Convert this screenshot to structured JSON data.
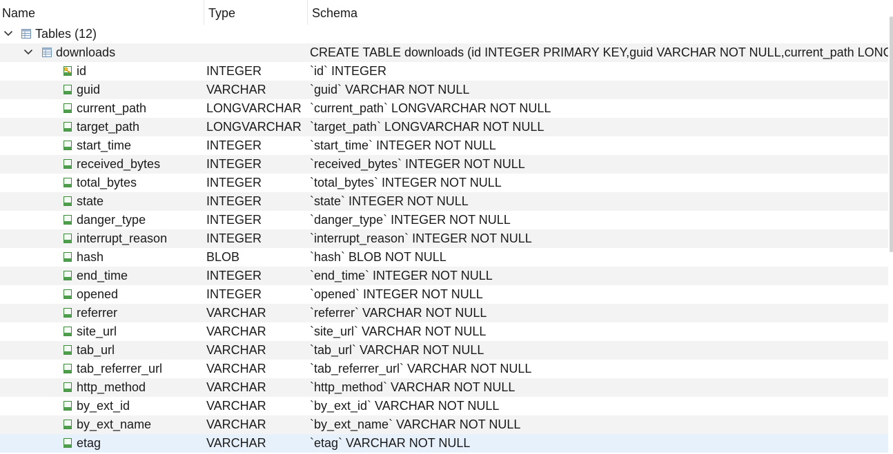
{
  "header": {
    "name_label": "Name",
    "type_label": "Type",
    "schema_label": "Schema"
  },
  "tables_node": {
    "label": "Tables (12)",
    "expanded": true,
    "icon": "table-icon"
  },
  "table": {
    "name": "downloads",
    "expanded": true,
    "icon": "table-icon",
    "schema": "CREATE TABLE downloads (id INTEGER PRIMARY KEY,guid VARCHAR NOT NULL,current_path LONGVARCHAR NOT NULL,target_path LONGVARCHAR NOT NULL,start_time INTEGER NOT NULL"
  },
  "columns": [
    {
      "name": "id",
      "type": "INTEGER",
      "schema": "`id` INTEGER",
      "icon": "primary-key-column-icon"
    },
    {
      "name": "guid",
      "type": "VARCHAR",
      "schema": "`guid` VARCHAR NOT NULL",
      "icon": "column-icon"
    },
    {
      "name": "current_path",
      "type": "LONGVARCHAR",
      "schema": "`current_path` LONGVARCHAR NOT NULL",
      "icon": "column-icon"
    },
    {
      "name": "target_path",
      "type": "LONGVARCHAR",
      "schema": "`target_path` LONGVARCHAR NOT NULL",
      "icon": "column-icon"
    },
    {
      "name": "start_time",
      "type": "INTEGER",
      "schema": "`start_time` INTEGER NOT NULL",
      "icon": "column-icon"
    },
    {
      "name": "received_bytes",
      "type": "INTEGER",
      "schema": "`received_bytes` INTEGER NOT NULL",
      "icon": "column-icon"
    },
    {
      "name": "total_bytes",
      "type": "INTEGER",
      "schema": "`total_bytes` INTEGER NOT NULL",
      "icon": "column-icon"
    },
    {
      "name": "state",
      "type": "INTEGER",
      "schema": "`state` INTEGER NOT NULL",
      "icon": "column-icon"
    },
    {
      "name": "danger_type",
      "type": "INTEGER",
      "schema": "`danger_type` INTEGER NOT NULL",
      "icon": "column-icon"
    },
    {
      "name": "interrupt_reason",
      "type": "INTEGER",
      "schema": "`interrupt_reason` INTEGER NOT NULL",
      "icon": "column-icon"
    },
    {
      "name": "hash",
      "type": "BLOB",
      "schema": "`hash` BLOB NOT NULL",
      "icon": "column-icon"
    },
    {
      "name": "end_time",
      "type": "INTEGER",
      "schema": "`end_time` INTEGER NOT NULL",
      "icon": "column-icon"
    },
    {
      "name": "opened",
      "type": "INTEGER",
      "schema": "`opened` INTEGER NOT NULL",
      "icon": "column-icon"
    },
    {
      "name": "referrer",
      "type": "VARCHAR",
      "schema": "`referrer` VARCHAR NOT NULL",
      "icon": "column-icon"
    },
    {
      "name": "site_url",
      "type": "VARCHAR",
      "schema": "`site_url` VARCHAR NOT NULL",
      "icon": "column-icon"
    },
    {
      "name": "tab_url",
      "type": "VARCHAR",
      "schema": "`tab_url` VARCHAR NOT NULL",
      "icon": "column-icon"
    },
    {
      "name": "tab_referrer_url",
      "type": "VARCHAR",
      "schema": "`tab_referrer_url` VARCHAR NOT NULL",
      "icon": "column-icon"
    },
    {
      "name": "http_method",
      "type": "VARCHAR",
      "schema": "`http_method` VARCHAR NOT NULL",
      "icon": "column-icon"
    },
    {
      "name": "by_ext_id",
      "type": "VARCHAR",
      "schema": "`by_ext_id` VARCHAR NOT NULL",
      "icon": "column-icon"
    },
    {
      "name": "by_ext_name",
      "type": "VARCHAR",
      "schema": "`by_ext_name` VARCHAR NOT NULL",
      "icon": "column-icon"
    },
    {
      "name": "etag",
      "type": "VARCHAR",
      "schema": "`etag` VARCHAR NOT NULL",
      "icon": "column-icon",
      "selected": true
    }
  ],
  "colors": {
    "row_alt": "#f3f3f3",
    "row_selected": "#e7f1fb",
    "icon_green": "#3a8a3a",
    "key_yellow": "#e0a800",
    "table_icon_blue": "#6b8fb0"
  }
}
